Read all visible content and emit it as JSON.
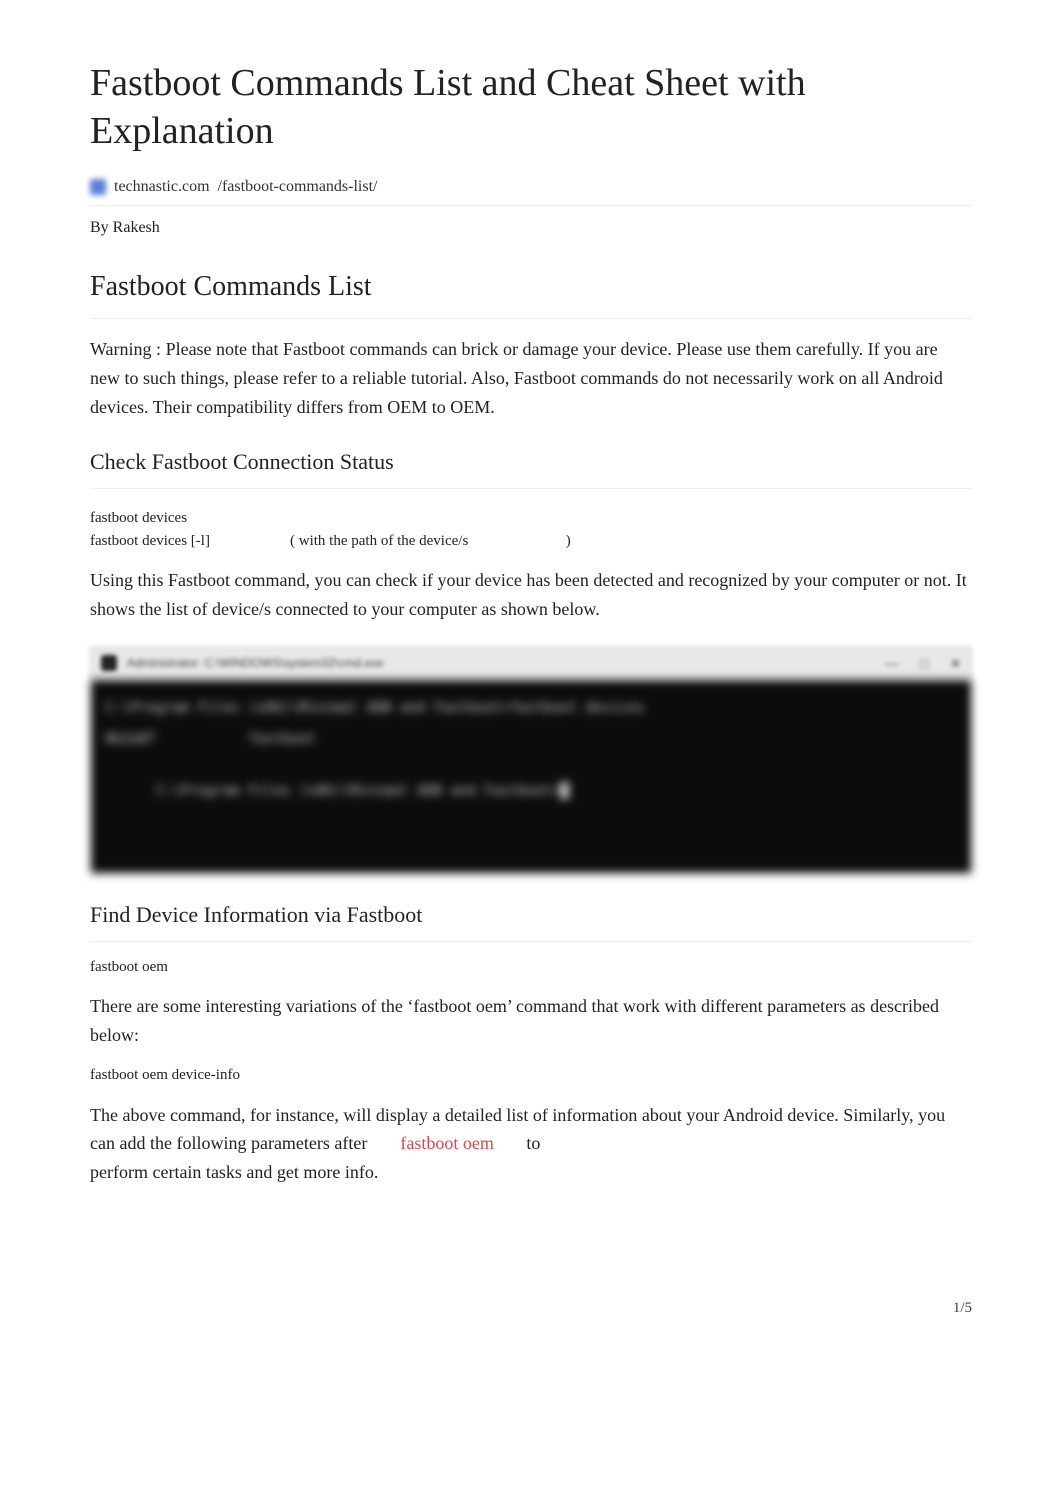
{
  "title": "Fastboot Commands List and Cheat Sheet with Explanation",
  "source": {
    "site": "technastic.com",
    "path": "/fastboot-commands-list/"
  },
  "author_line": "By Rakesh",
  "h2_1": "Fastboot Commands List",
  "warning": {
    "label": "Warning",
    "sep": ":",
    "text": "Please note that Fastboot commands can brick or damage your device. Please use them carefully. If you are new to such things, please refer to a reliable tutorial. Also, Fastboot commands do not necessarily work on all Android devices. Their compatibility differs from OEM to OEM."
  },
  "h3_1": "Check Fastboot Connection Status",
  "cmd1": {
    "a": "fastboot devices",
    "b": "fastboot devices [-l]",
    "b_note_open": "(",
    "b_note_text": "with the path of the device/s",
    "b_note_close": ")"
  },
  "para1": "Using this Fastboot command, you can check if your device has been detected and recognized by your computer or not. It shows the list of device/s connected to your computer as shown below.",
  "terminal": {
    "titlebar": "Administrator: C:\\WINDOWS\\system32\\cmd.exe",
    "controls": {
      "min": "—",
      "max": "□",
      "close": "✕"
    },
    "line1": "C:\\Program Files (x86)\\Minimal ADB and Fastboot>fastboot devices",
    "line2": "8b2a8f           fastboot",
    "line3": "C:\\Program Files (x86)\\Minimal ADB and Fastboot>"
  },
  "h3_2": "Find Device Information via Fastboot",
  "cmd2": "fastboot oem",
  "para2": "There are some interesting variations of the ‘fastboot oem’ command that work with different parameters as described below:",
  "cmd3": "fastboot oem device-info",
  "para3": {
    "text_a": "The above command, for instance, will display a detailed list of information about your Android device. Similarly, you can add the following parameters after",
    "inline_code": "fastboot oem",
    "text_b": "to",
    "text_c": "perform certain tasks and get more info."
  },
  "page_num": "1/5"
}
